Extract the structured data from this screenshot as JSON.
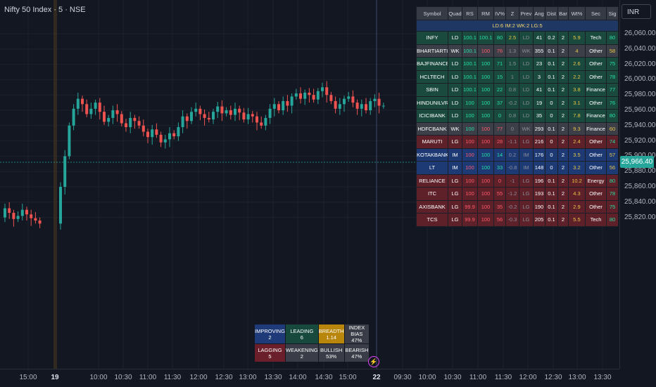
{
  "chart": {
    "title": "Nifty 50 Index · 5 · NSE",
    "currency": "INR",
    "current_price": "25,966.40",
    "price_axis": [
      "26,060.00",
      "26,040.00",
      "26,020.00",
      "26,000.00",
      "25,980.00",
      "25,960.00",
      "25,940.00",
      "25,920.00",
      "25,900.00",
      "25,880.00",
      "25,860.00",
      "25,840.00",
      "25,820.00"
    ],
    "time_axis": [
      {
        "label": "15:00",
        "bold": false
      },
      {
        "label": "19",
        "bold": true
      },
      {
        "label": "10:00",
        "bold": false
      },
      {
        "label": "10:30",
        "bold": false
      },
      {
        "label": "11:00",
        "bold": false
      },
      {
        "label": "11:30",
        "bold": false
      },
      {
        "label": "12:00",
        "bold": false
      },
      {
        "label": "12:30",
        "bold": false
      },
      {
        "label": "13:00",
        "bold": false
      },
      {
        "label": "13:30",
        "bold": false
      },
      {
        "label": "14:00",
        "bold": false
      },
      {
        "label": "14:30",
        "bold": false
      },
      {
        "label": "15:00",
        "bold": false
      },
      {
        "label": "22",
        "bold": true
      },
      {
        "label": "09:30",
        "bold": false
      },
      {
        "label": "10:00",
        "bold": false
      },
      {
        "label": "10:30",
        "bold": false
      },
      {
        "label": "11:00",
        "bold": false
      },
      {
        "label": "11:30",
        "bold": false
      },
      {
        "label": "12:00",
        "bold": false
      },
      {
        "label": "12:30",
        "bold": false
      },
      {
        "label": "13:00",
        "bold": false
      },
      {
        "label": "13:30",
        "bold": false
      }
    ],
    "colors": {
      "up": "#26a69a",
      "down": "#ef5350",
      "background": "#131722"
    }
  },
  "table": {
    "headers": [
      "Symbol",
      "Quad",
      "RS",
      "RM",
      "IV%",
      "Z",
      "Prev",
      "Ang",
      "Dist",
      "Bar",
      "Wt%",
      "Sec",
      "Sig"
    ],
    "summary": "LD:6 IM:2 WK:2 LG:5",
    "rows": [
      {
        "symbol": "INFY",
        "quad": "LD",
        "rs": "100.1",
        "rm": "100.1",
        "iv": "80",
        "z": "2.5",
        "prev": "LD",
        "ang": "41",
        "dist": "0.2",
        "bar": "2",
        "wt": "5.9",
        "sec": "Tech",
        "sig": "80"
      },
      {
        "symbol": "BHARTIARTL",
        "quad": "WK",
        "rs": "100.1",
        "rm": "100",
        "iv": "76",
        "z": "1.3",
        "prev": "WK",
        "ang": "355",
        "dist": "0.1",
        "bar": "2",
        "wt": "4",
        "sec": "Other",
        "sig": "58"
      },
      {
        "symbol": "BAJFINANCE",
        "quad": "LD",
        "rs": "100.1",
        "rm": "100",
        "iv": "71",
        "z": "1.5",
        "prev": "LD",
        "ang": "23",
        "dist": "0.1",
        "bar": "2",
        "wt": "2.6",
        "sec": "Other",
        "sig": "75"
      },
      {
        "symbol": "HCLTECH",
        "quad": "LD",
        "rs": "100.1",
        "rm": "100",
        "iv": "15",
        "z": "1",
        "prev": "LD",
        "ang": "3",
        "dist": "0.1",
        "bar": "2",
        "wt": "2.2",
        "sec": "Other",
        "sig": "78"
      },
      {
        "symbol": "SBIN",
        "quad": "LD",
        "rs": "100.1",
        "rm": "100",
        "iv": "22",
        "z": "0.8",
        "prev": "LD",
        "ang": "41",
        "dist": "0.1",
        "bar": "2",
        "wt": "3.8",
        "sec": "Finance",
        "sig": "77"
      },
      {
        "symbol": "HINDUNILVR",
        "quad": "LD",
        "rs": "100",
        "rm": "100",
        "iv": "37",
        "z": "-0.2",
        "prev": "LD",
        "ang": "19",
        "dist": "0",
        "bar": "2",
        "wt": "3.1",
        "sec": "Other",
        "sig": "76"
      },
      {
        "symbol": "ICICIBANK",
        "quad": "LD",
        "rs": "100",
        "rm": "100",
        "iv": "0",
        "z": "0.8",
        "prev": "LD",
        "ang": "35",
        "dist": "0",
        "bar": "2",
        "wt": "7.8",
        "sec": "Finance",
        "sig": "80"
      },
      {
        "symbol": "HDFCBANK",
        "quad": "WK",
        "rs": "100",
        "rm": "100",
        "iv": "77",
        "z": "0",
        "prev": "WK",
        "ang": "293",
        "dist": "0.1",
        "bar": "2",
        "wt": "9.3",
        "sec": "Finance",
        "sig": "60"
      },
      {
        "symbol": "MARUTI",
        "quad": "LG",
        "rs": "100",
        "rm": "100",
        "iv": "28",
        "z": "-1.1",
        "prev": "LG",
        "ang": "216",
        "dist": "0",
        "bar": "2",
        "wt": "2.4",
        "sec": "Other",
        "sig": "74"
      },
      {
        "symbol": "KOTAKBANK",
        "quad": "IM",
        "rs": "100",
        "rm": "100",
        "iv": "14",
        "z": "0.2",
        "prev": "IM",
        "ang": "176",
        "dist": "0",
        "bar": "2",
        "wt": "3.5",
        "sec": "Other",
        "sig": "57"
      },
      {
        "symbol": "LT",
        "quad": "IM",
        "rs": "100",
        "rm": "100",
        "iv": "33",
        "z": "-0.8",
        "prev": "IM",
        "ang": "148",
        "dist": "0",
        "bar": "2",
        "wt": "3.2",
        "sec": "Other",
        "sig": "56"
      },
      {
        "symbol": "RELIANCE",
        "quad": "LG",
        "rs": "100",
        "rm": "100",
        "iv": "0",
        "z": "-1",
        "prev": "LG",
        "ang": "196",
        "dist": "0.1",
        "bar": "2",
        "wt": "10.2",
        "sec": "Energy",
        "sig": "80"
      },
      {
        "symbol": "ITC",
        "quad": "LG",
        "rs": "100",
        "rm": "100",
        "iv": "55",
        "z": "-1.2",
        "prev": "LG",
        "ang": "193",
        "dist": "0.1",
        "bar": "2",
        "wt": "4.3",
        "sec": "Other",
        "sig": "78"
      },
      {
        "symbol": "AXISBANK",
        "quad": "LG",
        "rs": "99.9",
        "rm": "100",
        "iv": "35",
        "z": "-0.2",
        "prev": "LG",
        "ang": "190",
        "dist": "0.1",
        "bar": "2",
        "wt": "2.9",
        "sec": "Other",
        "sig": "75"
      },
      {
        "symbol": "TCS",
        "quad": "LG",
        "rs": "99.9",
        "rm": "100",
        "iv": "56",
        "z": "-0.3",
        "prev": "LG",
        "ang": "205",
        "dist": "0.1",
        "bar": "2",
        "wt": "5.5",
        "sec": "Tech",
        "sig": "80"
      }
    ]
  },
  "stats": [
    {
      "label": "IMPROVING",
      "value": "2",
      "color": "#1e3a78"
    },
    {
      "label": "LEADING",
      "value": "6",
      "color": "#174a3c"
    },
    {
      "label": "BREADTH",
      "value": "1.14",
      "color": "#b8860b"
    },
    {
      "label": "INDEX BIAS",
      "value": "47%",
      "color": "#3a3d47"
    },
    {
      "label": "LAGGING",
      "value": "5",
      "color": "#6b1f2a"
    },
    {
      "label": "WEAKENING",
      "value": "2",
      "color": "#3a3d47"
    },
    {
      "label": "BULLISH",
      "value": "53%",
      "color": "#3a3d47"
    },
    {
      "label": "BEARISH",
      "value": "47%",
      "color": "#3a3d47"
    }
  ]
}
